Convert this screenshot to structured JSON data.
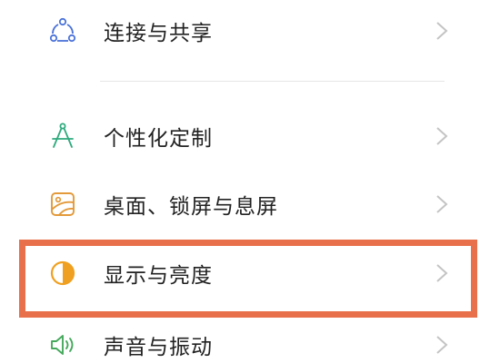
{
  "settings": {
    "items": [
      {
        "label": "连接与共享",
        "icon": "share-nodes-icon"
      },
      {
        "label": "个性化定制",
        "icon": "compass-icon"
      },
      {
        "label": "桌面、锁屏与息屏",
        "icon": "wallpaper-icon"
      },
      {
        "label": "显示与亮度",
        "icon": "brightness-icon"
      },
      {
        "label": "声音与振动",
        "icon": "speaker-icon"
      }
    ]
  },
  "colors": {
    "highlight_border": "#e8704a",
    "share_icon": "#4a72d9",
    "compass_icon": "#2eaa7e",
    "wallpaper_icon": "#e39a3a",
    "brightness_icon": "#f0a020",
    "speaker_icon": "#45a95c"
  }
}
